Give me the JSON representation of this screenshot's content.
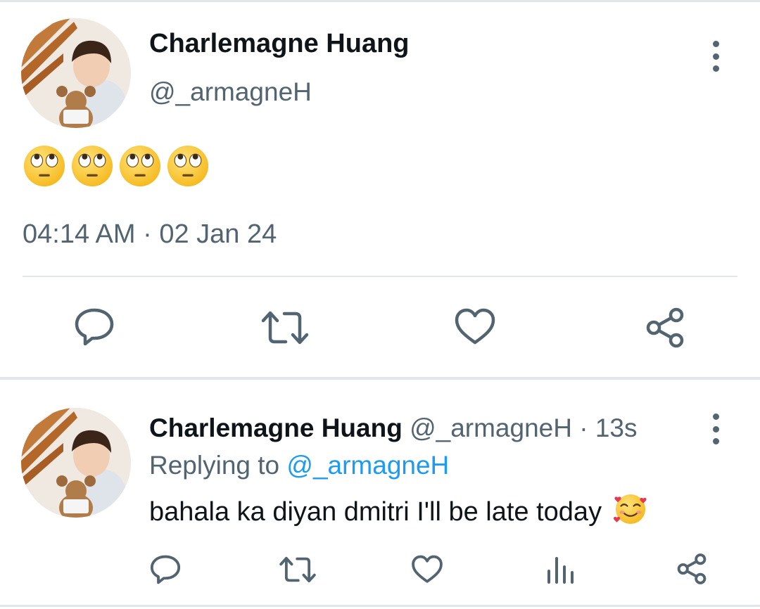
{
  "tweet": {
    "author_name": "Charlemagne Huang",
    "author_handle": "@_armagneH",
    "emoji_content": [
      "face-with-rolling-eyes",
      "face-with-rolling-eyes",
      "face-with-rolling-eyes",
      "face-with-rolling-eyes"
    ],
    "time": "04:14 AM",
    "separator": "·",
    "date": "02 Jan 24",
    "actions": [
      "reply-icon",
      "retweet-icon",
      "like-icon",
      "share-icon"
    ]
  },
  "reply": {
    "author_name": "Charlemagne Huang",
    "author_handle": "@_armagneH",
    "separator": "·",
    "age": "13s",
    "replying_prefix": "Replying to",
    "replying_handle": "@_armagneH",
    "text": "bahala ka diyan dmitri I'll be late today",
    "text_emoji": "smiling-face-with-hearts",
    "actions": [
      "reply-icon",
      "retweet-icon",
      "like-icon",
      "analytics-icon",
      "share-icon"
    ]
  },
  "colors": {
    "text": "#0f1419",
    "secondary": "#536471",
    "link": "#1d9bf0",
    "divider": "#e1e6ea"
  }
}
